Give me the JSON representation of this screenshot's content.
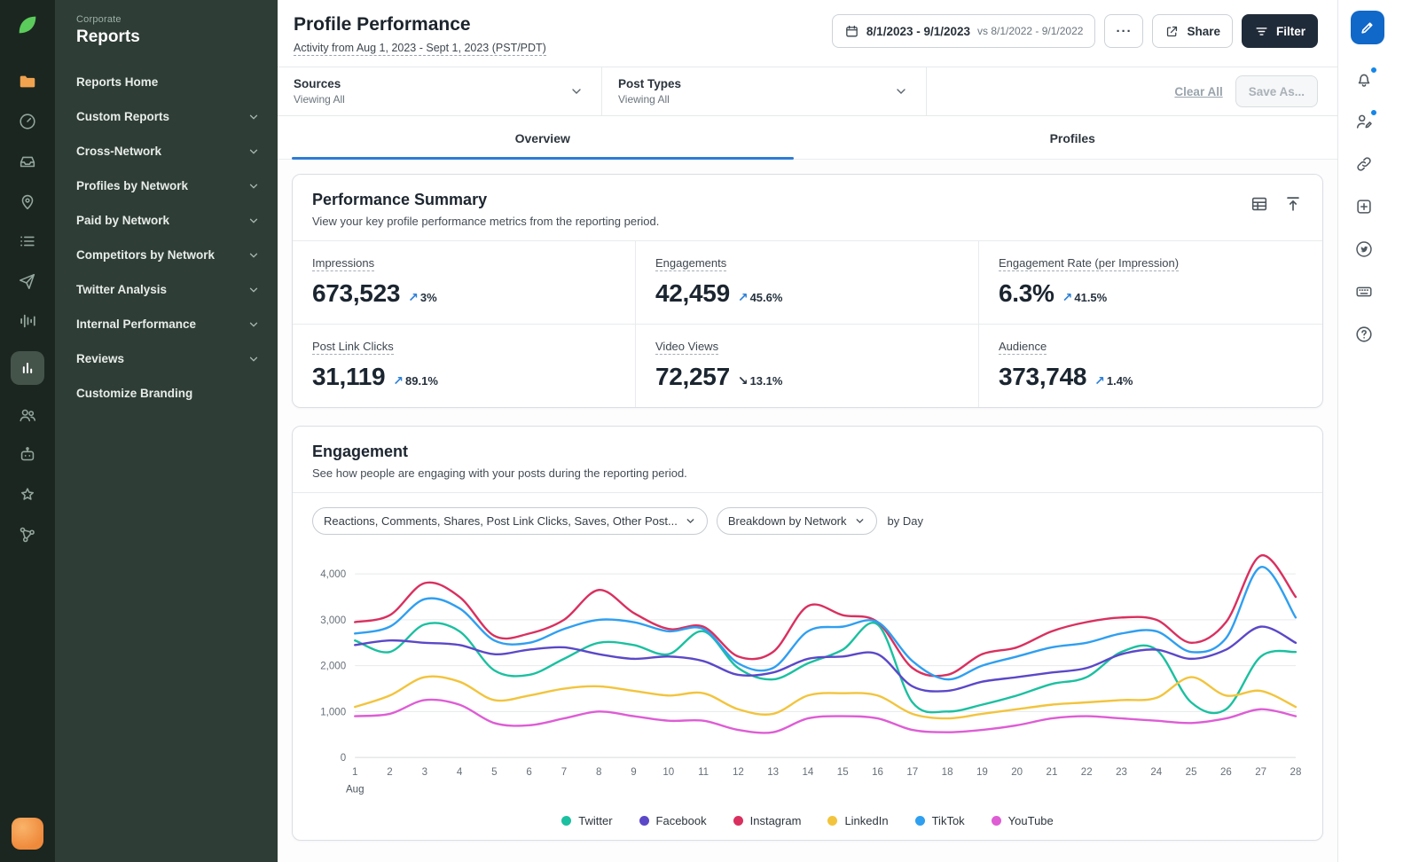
{
  "colors": {
    "accent_blue": "#2e7cd6",
    "positive_arrow": "#2b7fd8",
    "sprout_green": "#5bcb5b",
    "folder_orange": "#f0a24f",
    "avatar_orange": "#ef8a3c",
    "rail_bg": "#1b2620",
    "sidebar_bg": "#2e3d36",
    "filter_button_bg": "#202b39"
  },
  "icon_rail": [
    "sprout-leaf-logo",
    "folder",
    "gauge",
    "inbox",
    "pin",
    "list",
    "paper-plane",
    "audio-levels",
    "bar-chart-active",
    "people",
    "bot",
    "star",
    "network-nodes",
    "user-avatar"
  ],
  "right_rail": [
    "compose",
    "bell",
    "person-edit",
    "link",
    "plus-square",
    "twitter-bird",
    "keyboard",
    "help"
  ],
  "sidebar": {
    "eyebrow": "Corporate",
    "title": "Reports",
    "items": [
      {
        "label": "Reports Home",
        "chevron": false
      },
      {
        "label": "Custom Reports",
        "chevron": true
      },
      {
        "label": "Cross-Network",
        "chevron": true
      },
      {
        "label": "Profiles by Network",
        "chevron": true
      },
      {
        "label": "Paid by Network",
        "chevron": true
      },
      {
        "label": "Competitors by Network",
        "chevron": true
      },
      {
        "label": "Twitter Analysis",
        "chevron": true
      },
      {
        "label": "Internal Performance",
        "chevron": true
      },
      {
        "label": "Reviews",
        "chevron": true
      },
      {
        "label": "Customize Branding",
        "chevron": false
      }
    ]
  },
  "header": {
    "title": "Profile Performance",
    "subtitle": "Activity from Aug 1, 2023 - Sept 1, 2023 (PST/PDT)",
    "date_range": "8/1/2023 - 9/1/2023",
    "date_compare": "vs 8/1/2022 - 9/1/2022",
    "more_label": "···",
    "share_label": "Share",
    "filter_label": "Filter"
  },
  "filter_bar": {
    "sources_label": "Sources",
    "sources_value": "Viewing All",
    "post_types_label": "Post Types",
    "post_types_value": "Viewing All",
    "clear_all": "Clear All",
    "save_as": "Save As..."
  },
  "tabs": [
    {
      "label": "Overview",
      "active": true
    },
    {
      "label": "Profiles",
      "active": false
    }
  ],
  "performance_summary": {
    "title": "Performance Summary",
    "subtitle": "View your key profile performance metrics from the reporting period.",
    "metrics": [
      {
        "label": "Impressions",
        "value": "673,523",
        "change": "3%",
        "direction": "up"
      },
      {
        "label": "Engagements",
        "value": "42,459",
        "change": "45.6%",
        "direction": "up"
      },
      {
        "label": "Engagement Rate (per Impression)",
        "value": "6.3%",
        "change": "41.5%",
        "direction": "up"
      },
      {
        "label": "Post Link Clicks",
        "value": "31,119",
        "change": "89.1%",
        "direction": "up"
      },
      {
        "label": "Video Views",
        "value": "72,257",
        "change": "13.1%",
        "direction": "down"
      },
      {
        "label": "Audience",
        "value": "373,748",
        "change": "1.4%",
        "direction": "up"
      }
    ]
  },
  "engagement": {
    "title": "Engagement",
    "subtitle": "See how people are engaging with your posts during the reporting period.",
    "metric_filter": "Reactions, Comments, Shares, Post Link Clicks, Saves, Other Post...",
    "breakdown_filter": "Breakdown by Network",
    "by_label": "by Day"
  },
  "chart_data": {
    "type": "line",
    "x": [
      1,
      2,
      3,
      4,
      5,
      6,
      7,
      8,
      9,
      10,
      11,
      12,
      13,
      14,
      15,
      16,
      17,
      18,
      19,
      20,
      21,
      22,
      23,
      24,
      25,
      26,
      27,
      28
    ],
    "x_axis_label": "Aug",
    "ylim": [
      0,
      4000
    ],
    "yticks": [
      0,
      1000,
      2000,
      3000,
      4000
    ],
    "grid": true,
    "legend_position": "bottom",
    "series": [
      {
        "name": "Twitter",
        "color": "#1bc0a0",
        "values": [
          2550,
          2300,
          2900,
          2750,
          1900,
          1800,
          2150,
          2500,
          2450,
          2250,
          2750,
          1950,
          1700,
          2050,
          2350,
          2900,
          1200,
          1000,
          1150,
          1350,
          1600,
          1750,
          2300,
          2350,
          1200,
          1050,
          2200,
          2300
        ]
      },
      {
        "name": "Facebook",
        "color": "#5b48c8",
        "values": [
          2450,
          2550,
          2500,
          2450,
          2250,
          2350,
          2400,
          2250,
          2150,
          2200,
          2100,
          1800,
          1850,
          2150,
          2200,
          2250,
          1550,
          1450,
          1650,
          1750,
          1850,
          1950,
          2250,
          2350,
          2150,
          2350,
          2850,
          2500
        ]
      },
      {
        "name": "Instagram",
        "color": "#d9305f",
        "values": [
          2950,
          3100,
          3800,
          3500,
          2650,
          2700,
          3000,
          3650,
          3150,
          2800,
          2850,
          2200,
          2300,
          3300,
          3100,
          2950,
          1950,
          1800,
          2250,
          2400,
          2750,
          2950,
          3050,
          3000,
          2500,
          2950,
          4400,
          3500
        ]
      },
      {
        "name": "LinkedIn",
        "color": "#f2c43d",
        "values": [
          1100,
          1350,
          1750,
          1650,
          1250,
          1350,
          1500,
          1550,
          1450,
          1350,
          1400,
          1050,
          950,
          1350,
          1400,
          1350,
          950,
          850,
          950,
          1050,
          1150,
          1200,
          1250,
          1300,
          1750,
          1350,
          1450,
          1100
        ]
      },
      {
        "name": "TikTok",
        "color": "#2f9ff0",
        "values": [
          2700,
          2850,
          3450,
          3250,
          2550,
          2500,
          2800,
          3000,
          2950,
          2750,
          2800,
          2050,
          1950,
          2750,
          2850,
          2950,
          2100,
          1700,
          2000,
          2200,
          2400,
          2500,
          2700,
          2750,
          2300,
          2600,
          4150,
          3050
        ]
      },
      {
        "name": "YouTube",
        "color": "#de5dd5",
        "values": [
          900,
          950,
          1250,
          1150,
          750,
          700,
          850,
          1000,
          900,
          800,
          800,
          600,
          550,
          850,
          900,
          850,
          600,
          550,
          600,
          700,
          850,
          900,
          850,
          800,
          750,
          850,
          1050,
          900
        ]
      }
    ]
  }
}
